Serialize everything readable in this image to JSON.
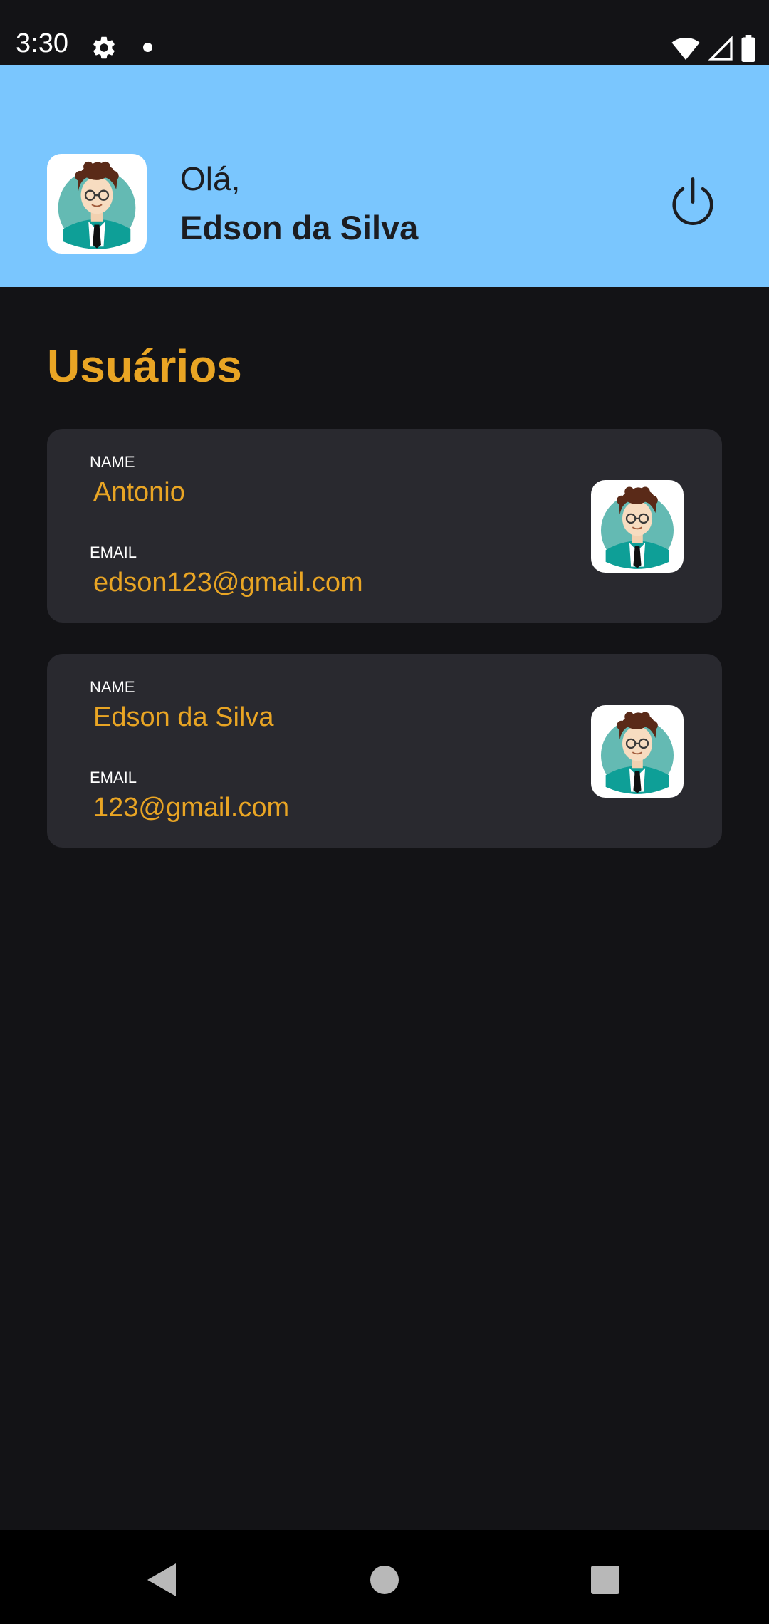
{
  "status_bar": {
    "time": "3:30"
  },
  "header": {
    "greeting": "Olá,",
    "username": "Edson da Silva"
  },
  "section": {
    "title": "Usuários"
  },
  "users": [
    {
      "name_label": "NAME",
      "name": "Antonio",
      "email_label": "EMAIL",
      "email": "edson123@gmail.com"
    },
    {
      "name_label": "NAME",
      "name": "Edson da Silva",
      "email_label": "EMAIL",
      "email": "123@gmail.com"
    }
  ],
  "colors": {
    "header_bg": "#7ac6fe",
    "app_bg": "#131316",
    "card_bg": "#29292f",
    "accent": "#e9a524"
  },
  "icons": {
    "settings": "gear-icon",
    "notification_dot": "dot-icon",
    "wifi": "wifi-icon",
    "signal": "signal-icon",
    "battery": "battery-icon",
    "logout": "power-icon",
    "avatar": "user-avatar-icon",
    "back": "back-triangle-icon",
    "home": "home-circle-icon",
    "recents": "recents-square-icon"
  }
}
